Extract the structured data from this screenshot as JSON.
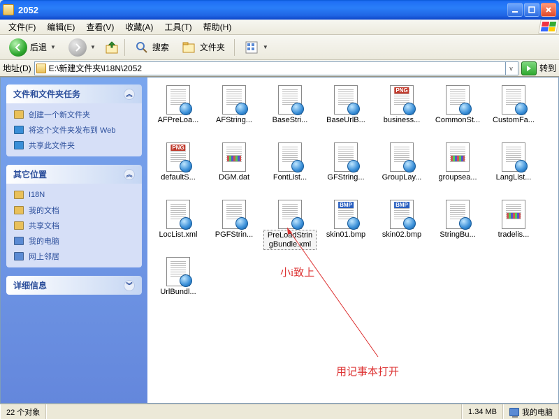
{
  "title": "2052",
  "menu": [
    "文件(F)",
    "编辑(E)",
    "查看(V)",
    "收藏(A)",
    "工具(T)",
    "帮助(H)"
  ],
  "toolbar": {
    "back": "后退",
    "search": "搜索",
    "folders": "文件夹"
  },
  "address": {
    "label": "地址(D)",
    "path": "E:\\新建文件夹\\I18N\\2052",
    "go": "转到"
  },
  "sidebar": {
    "tasks": {
      "title": "文件和文件夹任务",
      "items": [
        {
          "label": "创建一个新文件夹",
          "color": "#e9c05a"
        },
        {
          "label": "将这个文件夹发布到 Web",
          "color": "#3a8fd8"
        },
        {
          "label": "共享此文件夹",
          "color": "#3a8fd8"
        }
      ]
    },
    "places": {
      "title": "其它位置",
      "items": [
        {
          "label": "I18N",
          "color": "#e9c05a"
        },
        {
          "label": "我的文档",
          "color": "#e9c05a"
        },
        {
          "label": "共享文档",
          "color": "#e9c05a"
        },
        {
          "label": "我的电脑",
          "color": "#5b8bd4"
        },
        {
          "label": "网上邻居",
          "color": "#5b8bd4"
        }
      ]
    },
    "details": {
      "title": "详细信息"
    }
  },
  "files": [
    {
      "name": "AFPreLoa...",
      "type": "xml"
    },
    {
      "name": "AFString...",
      "type": "xml"
    },
    {
      "name": "BaseStri...",
      "type": "xml"
    },
    {
      "name": "BaseUrlB...",
      "type": "xml"
    },
    {
      "name": "business...",
      "type": "png"
    },
    {
      "name": "CommonSt...",
      "type": "xml"
    },
    {
      "name": "CustomFa...",
      "type": "xml"
    },
    {
      "name": "defaultS...",
      "type": "png"
    },
    {
      "name": "DGM.dat",
      "type": "dat"
    },
    {
      "name": "FontList...",
      "type": "xml"
    },
    {
      "name": "GFString...",
      "type": "xml"
    },
    {
      "name": "GroupLay...",
      "type": "xml"
    },
    {
      "name": "groupsea...",
      "type": "dat"
    },
    {
      "name": "LangList...",
      "type": "xml"
    },
    {
      "name": "LocList.xml",
      "type": "xml"
    },
    {
      "name": "PGFStrin...",
      "type": "xml"
    },
    {
      "name": "PreLoadStringBundle.xml",
      "type": "xml",
      "selected": true
    },
    {
      "name": "skin01.bmp",
      "type": "bmp"
    },
    {
      "name": "skin02.bmp",
      "type": "bmp"
    },
    {
      "name": "StringBu...",
      "type": "xml"
    },
    {
      "name": "tradelis...",
      "type": "dat"
    },
    {
      "name": "UrlBundl...",
      "type": "xml"
    }
  ],
  "annotations": {
    "top": "小i致上",
    "bottom": "用记事本打开"
  },
  "status": {
    "count": "22 个对象",
    "size": "1.34 MB",
    "zone": "我的电脑"
  }
}
